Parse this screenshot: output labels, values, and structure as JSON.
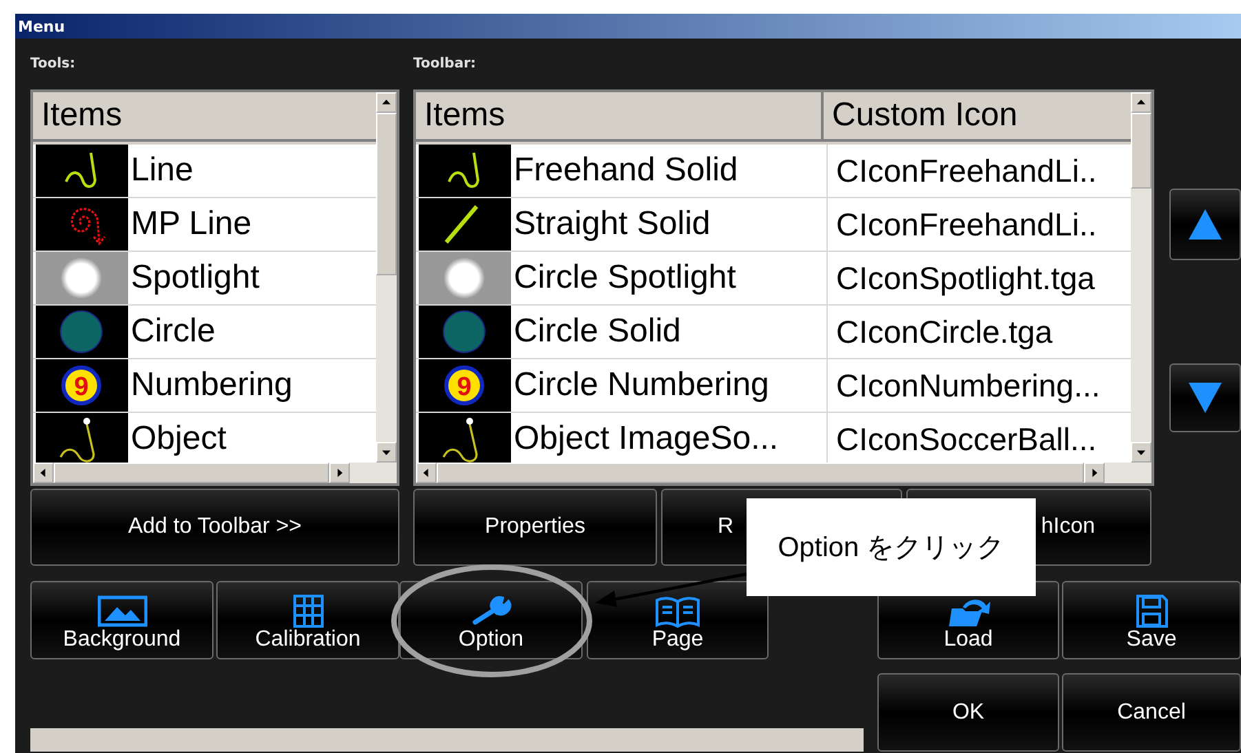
{
  "window": {
    "title": "Menu"
  },
  "tools": {
    "label": "Tools:",
    "columns": [
      "Items"
    ],
    "rows": [
      {
        "kind": "freehand",
        "name": "Line"
      },
      {
        "kind": "mp_line",
        "name": "MP Line"
      },
      {
        "kind": "spotlight",
        "name": "Spotlight"
      },
      {
        "kind": "circle",
        "name": "Circle"
      },
      {
        "kind": "numbering",
        "icon_text": "9",
        "name": "Numbering"
      },
      {
        "kind": "object",
        "name": "Object"
      }
    ]
  },
  "toolbar": {
    "label": "Toolbar:",
    "columns": [
      "Items",
      "Custom Icon"
    ],
    "rows": [
      {
        "kind": "freehand",
        "name": "Freehand Solid",
        "custom_icon": "CIconFreehandLi.."
      },
      {
        "kind": "straight",
        "name": "Straight Solid",
        "custom_icon": "CIconFreehandLi.."
      },
      {
        "kind": "spotlight",
        "name": "Circle Spotlight",
        "custom_icon": "CIconSpotlight.tga"
      },
      {
        "kind": "circle",
        "name": "Circle Solid",
        "custom_icon": "CIconCircle.tga"
      },
      {
        "kind": "numbering",
        "icon_text": "9",
        "name": "Circle Numbering",
        "custom_icon": "CIconNumbering..."
      },
      {
        "kind": "object",
        "name": "Object ImageSo...",
        "custom_icon": "CIconSoccerBall..."
      }
    ]
  },
  "move_buttons": [
    {
      "kind": "up"
    },
    {
      "kind": "down"
    }
  ],
  "list_buttons": [
    {
      "label": "Add to Toolbar >>"
    },
    {
      "label": "Properties"
    },
    {
      "label": "R"
    },
    {
      "label": "hIcon"
    }
  ],
  "tool_buttons": [
    {
      "label": "Background",
      "kind": "picture"
    },
    {
      "label": "Calibration",
      "kind": "grid"
    },
    {
      "label": "Option",
      "kind": "wrench"
    },
    {
      "label": "Page",
      "kind": "book"
    }
  ],
  "file_buttons": [
    {
      "label": "Load",
      "kind": "folder"
    },
    {
      "label": "Save",
      "kind": "floppy"
    }
  ],
  "dialog_buttons": [
    {
      "label": "OK"
    },
    {
      "label": "Cancel"
    }
  ],
  "callout": {
    "text": "Option をクリック"
  }
}
